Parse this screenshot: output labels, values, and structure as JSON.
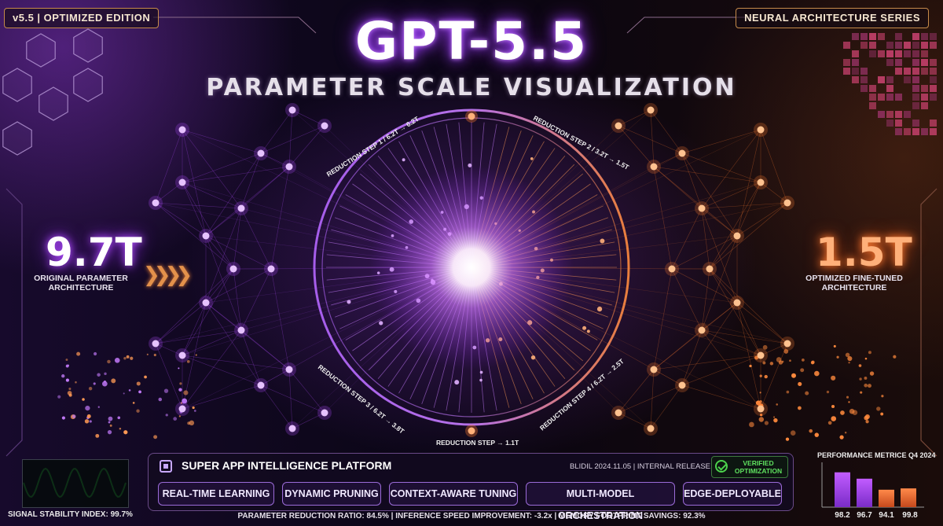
{
  "header": {
    "edition_tag": "v5.5 | OPTIMIZED EDITION",
    "series_tag": "NEURAL ARCHITECTURE SERIES",
    "title": "GPT-5.5",
    "subtitle": "PARAMETER SCALE VISUALIZATION"
  },
  "left_metric": {
    "value": "9.7T",
    "caption_line1": "ORIGINAL PARAMETER",
    "caption_line2": "ARCHITECTURE"
  },
  "right_metric": {
    "value": "1.5T",
    "caption_line1": "OPTIMIZED FINE-TUNED",
    "caption_line2": "ARCHITECTURE"
  },
  "reduction_steps": [
    "REDUCTION STEP 1 / 6.2T → 6.2T",
    "REDUCTION STEP 2 / 3.2T → 1.5T",
    "REDUCTION STEP 3 / 6.2T → 3.8T",
    "REDUCTION STEP → 1.1T",
    "REDUCTION STEP 4 / 6.2T → 2.5T"
  ],
  "signal": {
    "label": "SIGNAL STABILITY INDEX: 99.7%"
  },
  "platform": {
    "title": "SUPER APP INTELLIGENCE PLATFORM",
    "build": "BLIDIL 2024.11.05 | INTERNAL RELEASE",
    "verified_line1": "VERIFIED",
    "verified_line2": "OPTIMIZATION",
    "features": [
      "REAL-TIME LEARNING",
      "DYNAMIC PRUNING",
      "CONTEXT-AWARE TUNING",
      "MULTI-MODEL ORCHESTRATION",
      "EDGE-DEPLOYABLE"
    ]
  },
  "footer_stats": "PARAMETER REDUCTION RATIO: 84.5% | INFERENCE SPEED IMPROVEMENT: -3.2x | MEMORY FOOTPRINT SAVINGS: 92.3%",
  "performance": {
    "title": "PERFORMANCE METRICE Q4 2024",
    "values": [
      98.2,
      96.7,
      94.1,
      99.8
    ],
    "labels": [
      "98.2",
      "96.7",
      "94.1",
      "99.8"
    ]
  },
  "colors": {
    "purple": "#b14dff",
    "orange": "#ff7a2f",
    "green": "#4cd24c"
  }
}
